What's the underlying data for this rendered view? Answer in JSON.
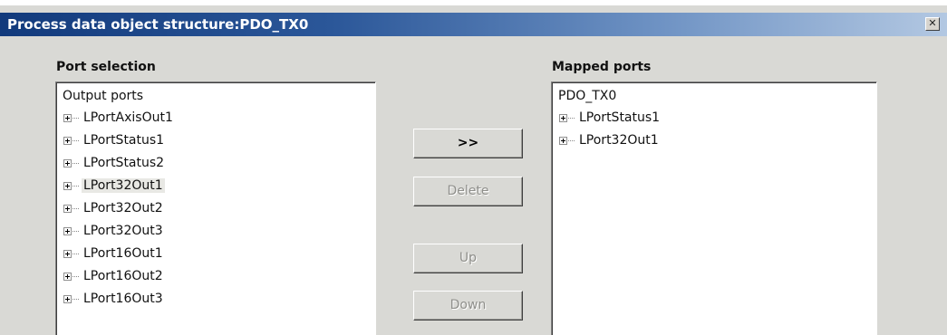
{
  "window": {
    "title": "Process data object structure:PDO_TX0",
    "close_glyph": "✕"
  },
  "port_selection": {
    "label": "Port selection",
    "root": "Output ports",
    "items": [
      {
        "label": "LPortAxisOut1",
        "selected": false
      },
      {
        "label": "LPortStatus1",
        "selected": false
      },
      {
        "label": "LPortStatus2",
        "selected": false
      },
      {
        "label": "LPort32Out1",
        "selected": true
      },
      {
        "label": "LPort32Out2",
        "selected": false
      },
      {
        "label": "LPort32Out3",
        "selected": false
      },
      {
        "label": "LPort16Out1",
        "selected": false
      },
      {
        "label": "LPort16Out2",
        "selected": false
      },
      {
        "label": "LPort16Out3",
        "selected": false
      }
    ]
  },
  "mapped_ports": {
    "label": "Mapped ports",
    "root": "PDO_TX0",
    "items": [
      {
        "label": "LPortStatus1"
      },
      {
        "label": "LPort32Out1"
      }
    ]
  },
  "buttons": {
    "add": {
      "label": ">>",
      "enabled": true
    },
    "delete": {
      "label": "Delete",
      "enabled": false
    },
    "up": {
      "label": "Up",
      "enabled": false
    },
    "down": {
      "label": "Down",
      "enabled": false
    }
  },
  "icons": {
    "expander": "plus-box-icon",
    "close": "close-icon"
  },
  "colors": {
    "title_bar_start": "#123a7c",
    "title_bar_end": "#b3c8e2",
    "dialog_background": "#d9d9d5"
  }
}
